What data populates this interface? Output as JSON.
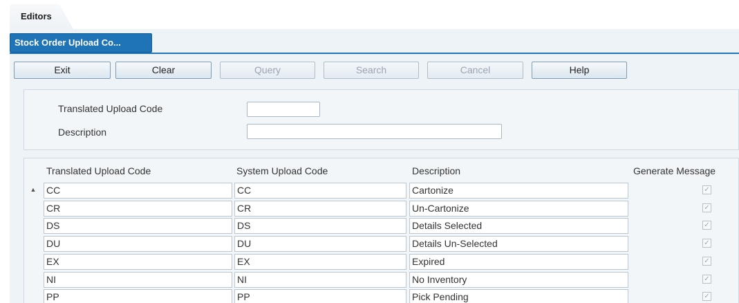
{
  "editors_tab": {
    "label": "Editors"
  },
  "document_tab": {
    "label": "Stock Order Upload Co..."
  },
  "toolbar": {
    "buttons": [
      {
        "label": "Exit",
        "enabled": true
      },
      {
        "label": "Clear",
        "enabled": true
      },
      {
        "label": "Query",
        "enabled": false
      },
      {
        "label": "Search",
        "enabled": false
      },
      {
        "label": "Cancel",
        "enabled": false
      },
      {
        "label": "Help",
        "enabled": true
      }
    ]
  },
  "search_form": {
    "translated_code_label": "Translated Upload Code",
    "translated_code_value": "",
    "description_label": "Description",
    "description_value": ""
  },
  "grid": {
    "columns": [
      "Translated Upload Code",
      "System Upload Code",
      "Description",
      "Generate Message"
    ],
    "rows": [
      {
        "translated": "CC",
        "system": "CC",
        "description": "Cartonize",
        "generate": true
      },
      {
        "translated": "CR",
        "system": "CR",
        "description": "Un-Cartonize",
        "generate": true
      },
      {
        "translated": "DS",
        "system": "DS",
        "description": "Details Selected",
        "generate": true
      },
      {
        "translated": "DU",
        "system": "DU",
        "description": "Details Un-Selected",
        "generate": true
      },
      {
        "translated": "EX",
        "system": "EX",
        "description": "Expired",
        "generate": true
      },
      {
        "translated": "NI",
        "system": "NI",
        "description": "No Inventory",
        "generate": true
      },
      {
        "translated": "PP",
        "system": "PP",
        "description": "Pick Pending",
        "generate": true
      }
    ]
  }
}
